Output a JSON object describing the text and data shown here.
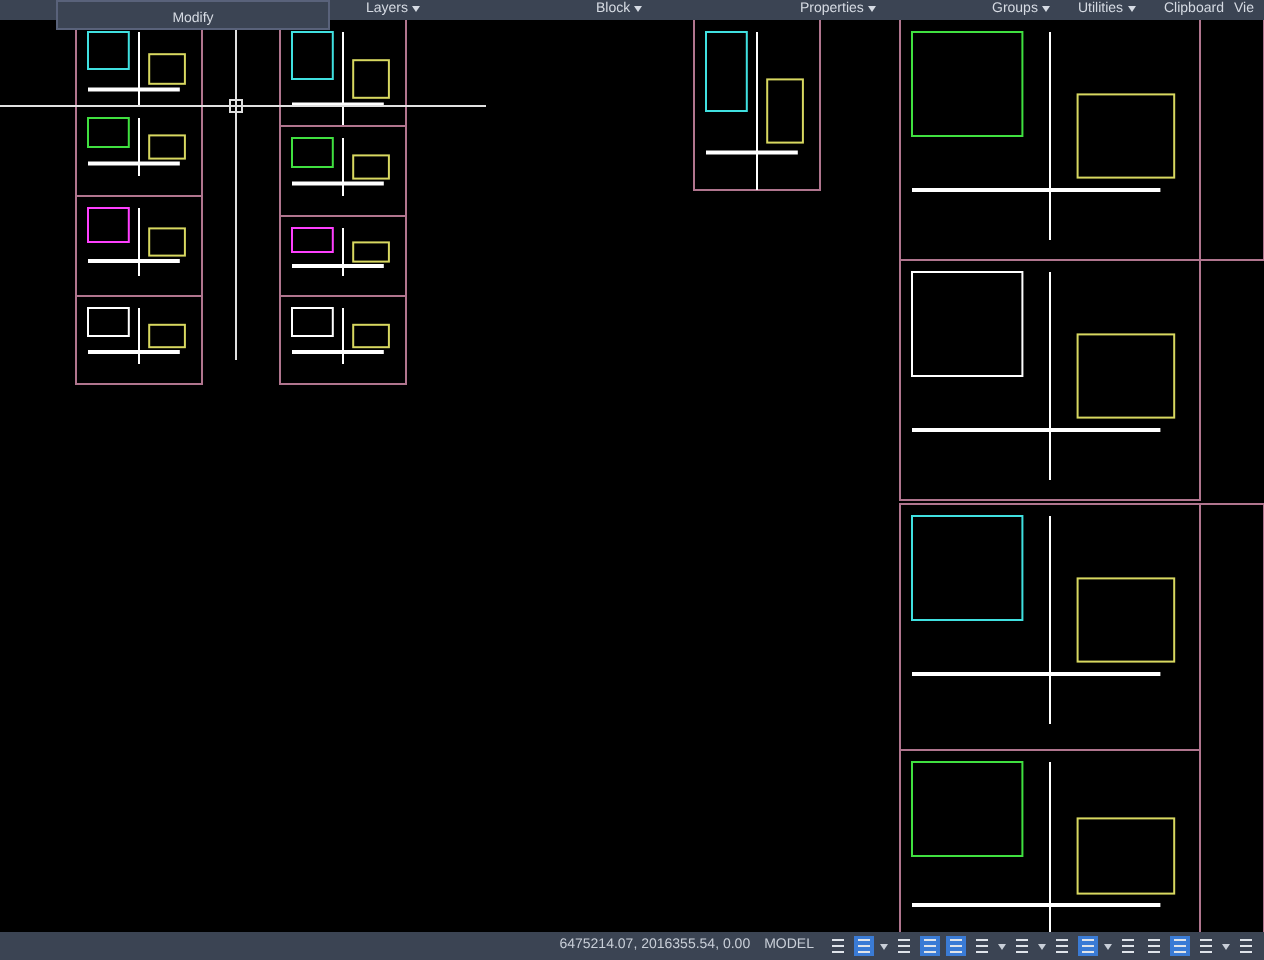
{
  "ribbon": {
    "panels": [
      {
        "label": "Layers",
        "dropdown": true
      },
      {
        "label": "Block",
        "dropdown": true
      },
      {
        "label": "Properties",
        "dropdown": true
      },
      {
        "label": "Groups",
        "dropdown": true
      },
      {
        "label": "Utilities",
        "dropdown": true
      },
      {
        "label": "Clipboard",
        "dropdown": false
      },
      {
        "label": "Vie",
        "dropdown": false
      }
    ],
    "expanded_panel": {
      "label": "Modify"
    }
  },
  "status_bar": {
    "coordinates": "6475214.07, 2016355.54, 0.00",
    "space": "MODEL"
  }
}
